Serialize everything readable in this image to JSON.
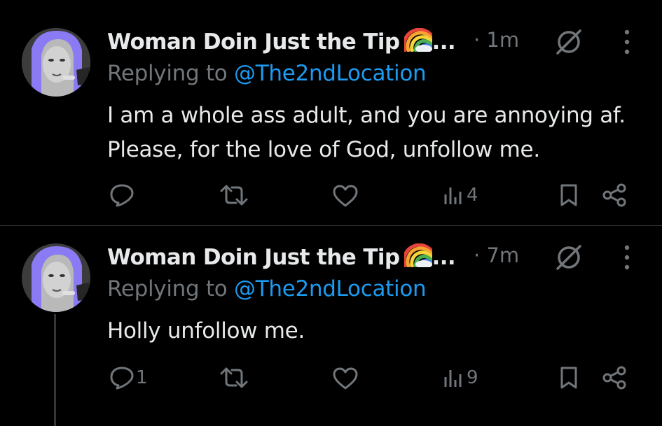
{
  "tweets": [
    {
      "author": "Woman Doin Just the Tip",
      "author_emoji": "rainbow-emoji",
      "truncation": "...",
      "time": "· 1m",
      "replying_prefix": "Replying to ",
      "replying_handle": "@The2ndLocation",
      "text": "I am a whole ass adult, and you are annoying af. Please, for the love of God, unfollow me.",
      "reply_count": "",
      "view_count": "4"
    },
    {
      "author": "Woman Doin Just the Tip",
      "author_emoji": "rainbow-emoji",
      "truncation": "...",
      "time": "· 7m",
      "replying_prefix": "Replying to ",
      "replying_handle": "@The2ndLocation",
      "text": "Holly unfollow me.",
      "reply_count": "1",
      "view_count": "9"
    }
  ],
  "colors": {
    "background": "#000000",
    "text": "#e7e9ea",
    "muted": "#71767b",
    "link": "#1d9bf0",
    "divider": "#2f3336",
    "avatar_accent": "#8a7bf4"
  }
}
